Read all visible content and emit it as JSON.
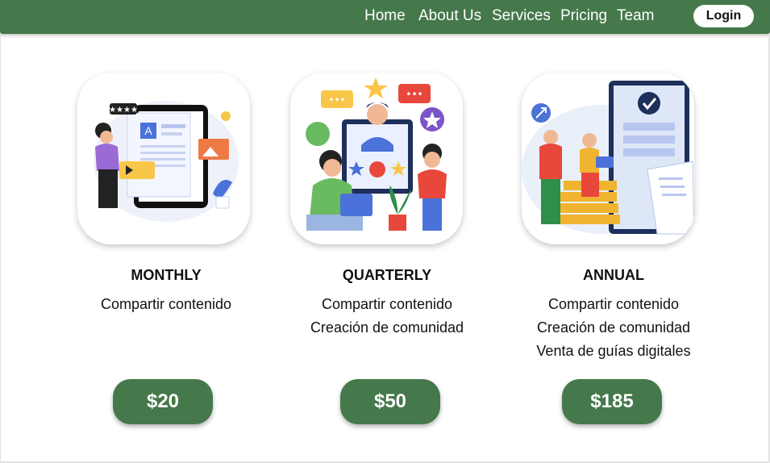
{
  "nav": {
    "links": [
      {
        "label": "Home"
      },
      {
        "label": "About Us"
      },
      {
        "label": "Services"
      },
      {
        "label": "Pricing"
      },
      {
        "label": "Team"
      }
    ],
    "login_label": "Login"
  },
  "plans": [
    {
      "name": "MONTHLY",
      "features": [
        "Compartir contenido"
      ],
      "price": "$20"
    },
    {
      "name": "QUARTERLY",
      "features": [
        "Compartir contenido",
        "Creación de comunidad"
      ],
      "price": "$50"
    },
    {
      "name": "ANNUAL",
      "features": [
        "Compartir contenido",
        "Creación de comunidad",
        "Venta de guías digitales"
      ],
      "price": "$185"
    }
  ],
  "colors": {
    "brand_green": "#45784a",
    "text": "#111111",
    "background": "#ffffff"
  }
}
